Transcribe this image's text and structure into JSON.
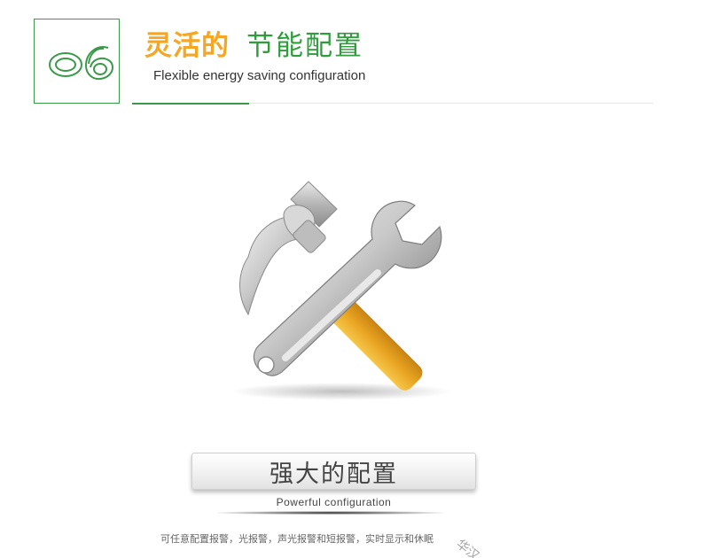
{
  "header": {
    "number": "06",
    "title_highlight": "灵活的",
    "title_main": "节能配置",
    "subtitle": "Flexible energy saving configuration"
  },
  "illustration": {
    "icon": "hammer-and-wrench-icon"
  },
  "feature": {
    "label": "强大的配置",
    "label_en": "Powerful configuration",
    "description": "可任意配置报警，光报警，声光报警和短报警，实时显示和休眠"
  },
  "watermark": "华汉",
  "colors": {
    "accent_green": "#3a9a4a",
    "accent_orange": "#f5a623"
  }
}
